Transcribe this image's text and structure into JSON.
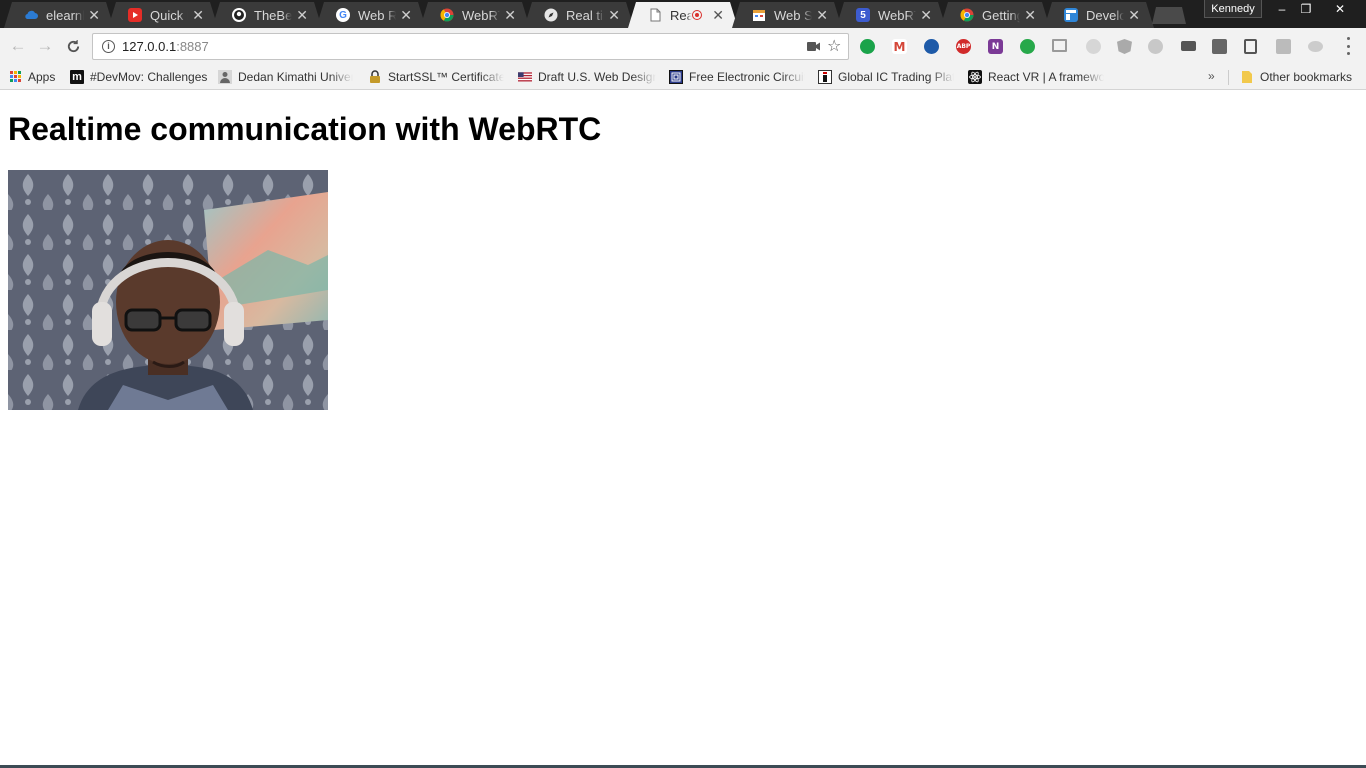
{
  "browser": {
    "tabs": [
      {
        "title": "elearnhe",
        "favicon": "cloud-icon",
        "color": "#2b7bd3",
        "active": false
      },
      {
        "title": "Quick lo",
        "favicon": "youtube-icon",
        "color": "#e52d27",
        "active": false
      },
      {
        "title": "TheBead",
        "favicon": "github-icon",
        "color": "#ffffff",
        "active": false
      },
      {
        "title": "Web RTC",
        "favicon": "google-icon",
        "color": "#4285f4",
        "active": false
      },
      {
        "title": "WebRTC",
        "favicon": "chrome-icon",
        "color": "#f4b400",
        "active": false
      },
      {
        "title": "Real tim",
        "favicon": "compass-icon",
        "color": "#cfcfcf",
        "active": false
      },
      {
        "title": "Realt",
        "favicon": "document-icon",
        "color": "#888888",
        "active": true,
        "recording": true
      },
      {
        "title": "Web Se",
        "favicon": "calendar-icon",
        "color": "#e8a13a",
        "active": false
      },
      {
        "title": "WebRTC",
        "favicon": "html5-icon",
        "color": "#3d5ccf",
        "active": false
      },
      {
        "title": "Getting",
        "favicon": "chrome-icon",
        "color": "#f4b400",
        "active": false
      },
      {
        "title": "Develop",
        "favicon": "layout-icon",
        "color": "#2f86d8",
        "active": false
      }
    ],
    "profile_name": "Kennedy",
    "window_controls": {
      "minimize": "–",
      "restore": "❐",
      "close": "✕"
    }
  },
  "toolbar": {
    "url_host": "127.0.0.1",
    "url_port": ":8887"
  },
  "extensions": [
    {
      "name": "evernote-icon",
      "label": "",
      "color": "#1aa34a"
    },
    {
      "name": "gmail-icon",
      "label": "M",
      "color": "#d44638"
    },
    {
      "name": "eagle-icon",
      "label": "",
      "color": "#1e5aa8"
    },
    {
      "name": "adblock-icon",
      "label": "ABP",
      "color": "#d12b2b"
    },
    {
      "name": "onenote-icon",
      "label": "N",
      "color": "#7b3a96"
    },
    {
      "name": "share-icon",
      "label": "",
      "color": "#27a84a"
    },
    {
      "name": "monitor-icon",
      "label": "",
      "color": "#9a9a9a"
    },
    {
      "name": "puzzle-icon",
      "label": "",
      "color": "#bdbdbd"
    },
    {
      "name": "angular-icon",
      "label": "",
      "color": "#aaaaaa"
    },
    {
      "name": "eye-icon",
      "label": "",
      "color": "#b5b5b5"
    },
    {
      "name": "bus-icon",
      "label": "",
      "color": "#555555"
    },
    {
      "name": "clipboard-icon",
      "label": "",
      "color": "#666666"
    },
    {
      "name": "bulb-icon",
      "label": "",
      "color": "#555555"
    },
    {
      "name": "exit-icon",
      "label": "",
      "color": "#999999"
    },
    {
      "name": "cloud-icon",
      "label": "",
      "color": "#bbbbbb"
    }
  ],
  "bookmarks": {
    "items": [
      {
        "label": "Apps",
        "icon": "apps-grid-icon",
        "color": "#ffffff"
      },
      {
        "label": "#DevMov: Challenges",
        "icon": "m-icon",
        "color": "#111111"
      },
      {
        "label": "Dedan Kimathi Univer",
        "icon": "person-icon",
        "color": "#7a7a7a"
      },
      {
        "label": "StartSSL™ Certificates",
        "icon": "lock-icon",
        "color": "#c49a2a"
      },
      {
        "label": "Draft U.S. Web Design",
        "icon": "us-flag-icon",
        "color": "#b22234"
      },
      {
        "label": "Free Electronic Circuit",
        "icon": "circuit-icon",
        "color": "#2a3a8a"
      },
      {
        "label": "Global IC Trading Platf",
        "icon": "ic-icon",
        "color": "#1a1a1a"
      },
      {
        "label": "React VR | A framewo",
        "icon": "react-icon",
        "color": "#111111"
      }
    ],
    "other_label": "Other bookmarks"
  },
  "page": {
    "title": "Realtime communication with WebRTC"
  }
}
